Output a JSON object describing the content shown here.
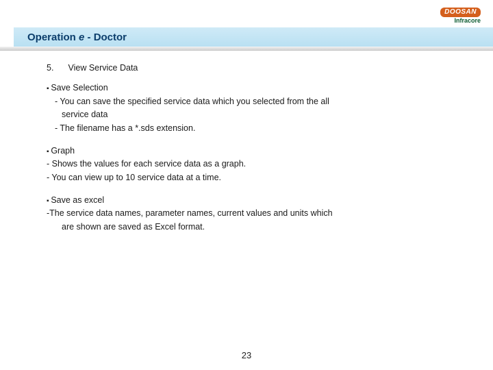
{
  "logo": {
    "brand": "DOOSAN",
    "sub": "Infracore"
  },
  "title": {
    "prefix": "Operation ",
    "e": "e",
    "suffix": " - Doctor"
  },
  "heading": {
    "num": "5.",
    "text": "View Service Data"
  },
  "save_selection": {
    "title": "Save Selection",
    "l1a": "- You can save the specified service data which you selected from the all",
    "l1b": "service data",
    "l2": "- The filename has a *.sds extension."
  },
  "graph": {
    "title": "Graph",
    "l1": " - Shows the values for each service data as a graph.",
    "l2": "- You can view up to 10 service data at a time."
  },
  "save_excel": {
    "title": "Save as excel",
    "l1a": "-The service data names, parameter names, current values and units which",
    "l1b": "are shown are saved as Excel format."
  },
  "page_number": "23"
}
